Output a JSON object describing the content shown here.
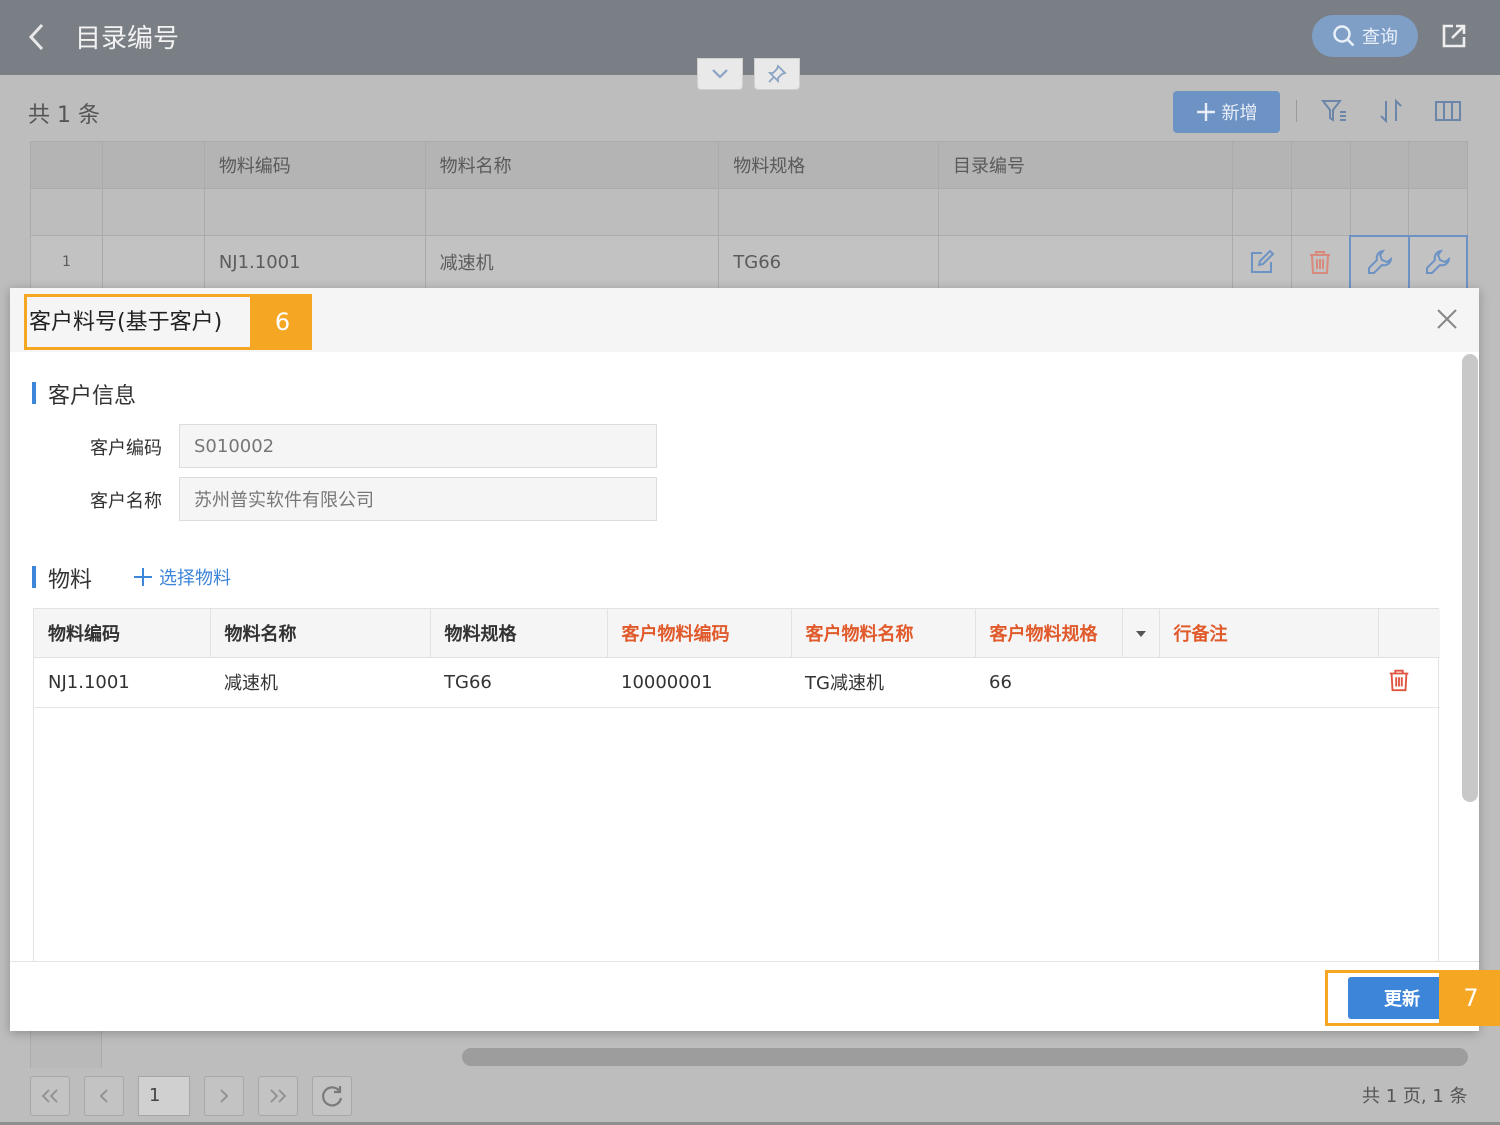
{
  "header": {
    "title": "目录编号",
    "query_label": "查询"
  },
  "toolbar": {
    "count_text": "共 1 条",
    "add_label": "新增"
  },
  "list_table": {
    "columns": [
      "物料编码",
      "物料名称",
      "物料规格",
      "目录编号"
    ],
    "rows": [
      {
        "index": "1",
        "code": "NJ1.1001",
        "name": "减速机",
        "spec": "TG66",
        "catalog": ""
      }
    ]
  },
  "pager": {
    "page_value": "1",
    "summary": "共 1 页, 1 条"
  },
  "modal": {
    "title": "客户料号(基于客户)",
    "callout_title": "6",
    "callout_update": "7",
    "customer_section": "客户信息",
    "customer_code_label": "客户编码",
    "customer_code_value": "S010002",
    "customer_name_label": "客户名称",
    "customer_name_value": "苏州普实软件有限公司",
    "material_section": "物料",
    "select_material_label": "选择物料",
    "grid": {
      "columns": [
        "物料编码",
        "物料名称",
        "物料规格",
        "客户物料编码",
        "客户物料名称",
        "客户物料规格",
        "",
        "行备注",
        ""
      ],
      "rows": [
        {
          "code": "NJ1.1001",
          "name": "减速机",
          "spec": "TG66",
          "cust_code": "10000001",
          "cust_name": "TG减速机",
          "cust_spec": "66",
          "remark": ""
        }
      ]
    },
    "update_label": "更新"
  },
  "colors": {
    "accent": "#3d85d8",
    "required": "#e05a2b",
    "delete": "#e0533f",
    "callout": "#f5a623"
  }
}
